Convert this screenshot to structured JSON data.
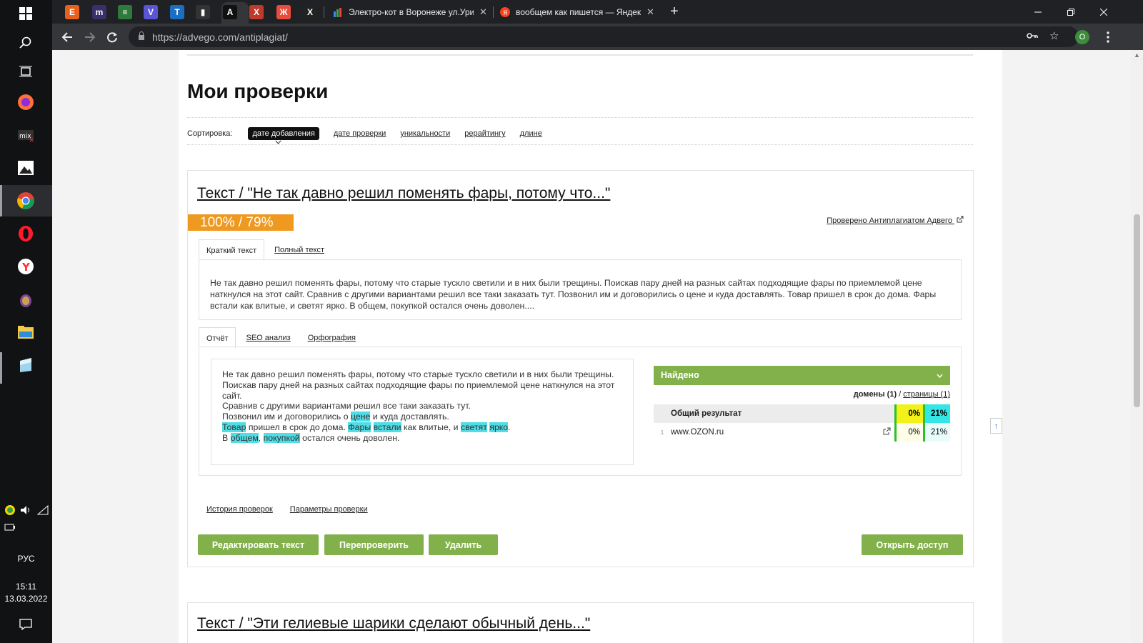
{
  "taskbar": {
    "tray_lang": "РУС",
    "time": "15:11",
    "date": "13.03.2022",
    "icons": [
      "start-icon",
      "search-icon",
      "task-view-icon",
      "firefox-icon",
      "mix-icon",
      "photos-icon",
      "chrome-icon",
      "opera-icon",
      "yandex-icon",
      "tor-icon",
      "folder-icon",
      "app-icon"
    ]
  },
  "browser": {
    "tabs": [
      {
        "icon": "E",
        "color": "#e8601c"
      },
      {
        "icon": "m",
        "color": "#3b2f6b"
      },
      {
        "icon": "≡",
        "color": "#2d7a3a"
      },
      {
        "icon": "V",
        "color": "#5a55d6"
      },
      {
        "icon": "T",
        "color": "#1b6ec2"
      },
      {
        "icon": "▮",
        "color": "#333"
      },
      {
        "icon": "A",
        "color": "#111"
      },
      {
        "icon": "Х",
        "color": "#c0392b"
      },
      {
        "icon": "Ж",
        "color": "#e84c3d"
      },
      {
        "icon": "X",
        "color": "#222"
      }
    ],
    "wide_tabs": [
      {
        "title": "Электро-кот в Воронеже ул.Ури",
        "close": "✕"
      },
      {
        "title": "вообщем как пишется — Яндекс",
        "close": "✕"
      }
    ],
    "new_tab": "+",
    "url": "https://advego.com/antiplagiat/",
    "profile_letter": "O"
  },
  "page": {
    "title": "Мои проверки",
    "sort": {
      "label": "Сортировка:",
      "options": [
        "дате добавления",
        "дате проверки",
        "уникальности",
        "рерайтингу",
        "длине"
      ]
    },
    "card": {
      "title": "Текст / \"Не так давно решил поменять фары, потому что...\"",
      "score": "100% / 79%",
      "checked_by": "Проверено Антиплагиатом Адвего",
      "text_tabs": [
        "Краткий текст",
        "Полный текст"
      ],
      "short_text": "Не так давно решил поменять фары, потому что старые тускло светили и в них были трещины. Поискав пару дней на разных сайтах подходящие фары по приемлемой цене наткнулся на этот сайт. Сравнив с другими вариантами решил все таки заказать тут. Позвонил им и договорились о цене и куда доставлять. Товар пришел в срок до дома. Фары встали как влитые, и светят ярко. В общем, покупкой остался очень доволен....",
      "report_tabs": [
        "Отчёт",
        "SEO анализ",
        "Орфография"
      ],
      "report_lines": {
        "l1": "Не так давно решил поменять фары, потому что старые тускло светили и в них были трещины.",
        "l2": "Поискав пару дней на разных сайтах подходящие фары по приемлемой цене наткнулся на этот сайт.",
        "l3": "Сравнив с другими вариантами решил все таки заказать тут.",
        "l4a": "Позвонил им и договорились о ",
        "l4b": "цене",
        "l4c": " и куда доставлять.",
        "l5a": "Товар",
        "l5b": " пришел в срок до дома. ",
        "l5c": "Фары",
        "l5d": " ",
        "l5e": "встали",
        "l5f": " как влитые, и ",
        "l5g": "светят",
        "l5h": " ",
        "l5i": "ярко",
        "l5j": ".",
        "l6a": "В ",
        "l6b": "общем",
        "l6c": ", ",
        "l6d": "покупкой",
        "l6e": " остался очень доволен."
      },
      "found": {
        "header": "Найдено",
        "domains_label": "домены",
        "domains_count": "(1)",
        "sep": " / ",
        "pages_label": "страницы (1)",
        "total_label": "Общий результат",
        "total_p1": "0%",
        "total_p2": "21%",
        "sites": [
          {
            "num": "1",
            "name": "www.OZON.ru",
            "p1": "0%",
            "p2": "21%"
          }
        ]
      },
      "links": [
        "История проверок",
        "Параметры проверки"
      ],
      "buttons": {
        "edit": "Редактировать текст",
        "recheck": "Перепроверить",
        "delete": "Удалить",
        "share": "Открыть доступ"
      }
    },
    "card2_title": "Текст / \"Эти гелиевые шарики сделают обычный день...\""
  }
}
